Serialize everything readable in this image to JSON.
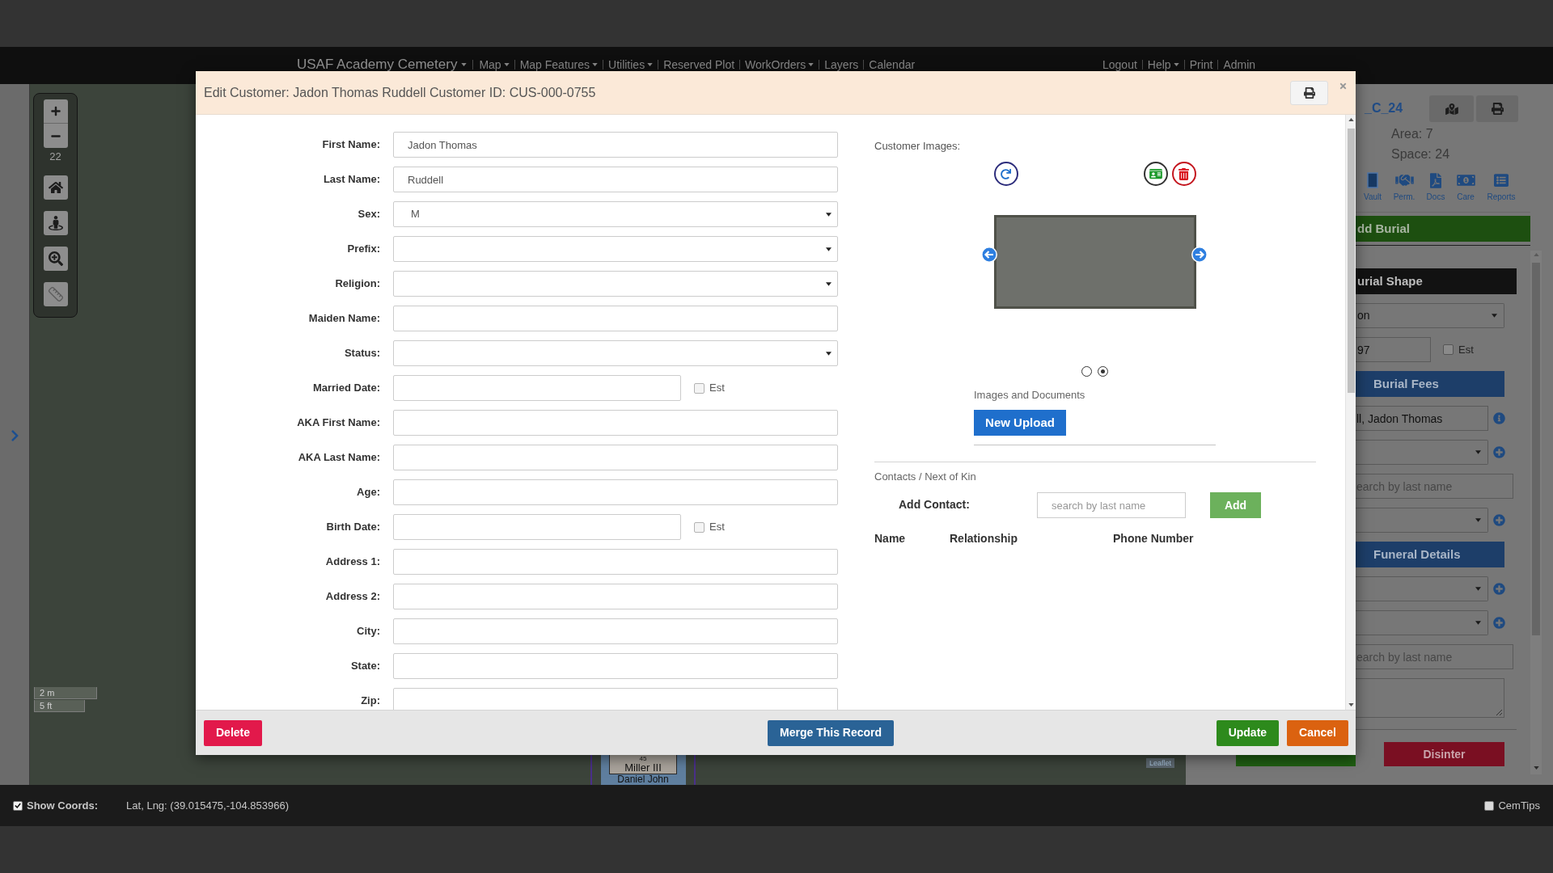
{
  "nav": {
    "brand": {
      "label": "USAF Academy Cemetery",
      "dropdown": true
    },
    "menu": [
      {
        "label": "Map",
        "dropdown": true
      },
      {
        "label": "Map Features",
        "dropdown": true
      },
      {
        "label": "Utilities",
        "dropdown": true
      },
      {
        "label": "Reserved Plot",
        "dropdown": false
      },
      {
        "label": "WorkOrders",
        "dropdown": true
      },
      {
        "label": "Layers",
        "dropdown": false
      },
      {
        "label": "Calendar",
        "dropdown": false
      }
    ],
    "right_menu": [
      {
        "label": "Logout",
        "dropdown": false
      },
      {
        "label": "Help",
        "dropdown": true
      },
      {
        "label": "Print",
        "dropdown": false
      },
      {
        "label": "Admin",
        "dropdown": false
      }
    ]
  },
  "map": {
    "zoom_level": "22",
    "scale": [
      "2 m",
      "5 ft"
    ],
    "plot": {
      "number": "45",
      "names": [
        "Miller III",
        "Daniel John"
      ]
    },
    "attribution": "Leaflet"
  },
  "sidebar": {
    "title": "_C_24",
    "details": [
      "Area: 7",
      "Space: 24"
    ],
    "tools": [
      {
        "kind": "vault",
        "label": "Vault"
      },
      {
        "kind": "permit",
        "label": "Perm."
      },
      {
        "kind": "docs",
        "label": "Docs"
      },
      {
        "kind": "care",
        "label": "Care"
      },
      {
        "kind": "reports",
        "label": "Reports"
      }
    ],
    "add_button": "dd Burial",
    "form": [
      {
        "kind": "header",
        "label": "urial Shape"
      },
      {
        "kind": "select",
        "value": "on"
      },
      {
        "kind": "date",
        "value": "97",
        "est": {
          "label": "Est",
          "checked": false
        }
      },
      {
        "kind": "section",
        "label": "Burial Fees"
      },
      {
        "kind": "input",
        "value": "ll, Jadon Thomas",
        "info": true
      },
      {
        "kind": "select",
        "addable": true
      },
      {
        "kind": "search",
        "placeholder": "earch by last name"
      },
      {
        "kind": "select",
        "addable": true
      },
      {
        "kind": "section",
        "label": "Funeral Details"
      },
      {
        "kind": "select",
        "addable": true
      },
      {
        "kind": "select",
        "addable": true
      },
      {
        "kind": "search",
        "placeholder": "earch by last name"
      },
      {
        "kind": "textarea"
      }
    ],
    "disinter_button": "Disinter"
  },
  "modal": {
    "title": "Edit Customer: Jadon Thomas Ruddell Customer ID: CUS-000-0755",
    "fields": [
      {
        "label": "First Name:",
        "kind": "text",
        "value": "Jadon Thomas"
      },
      {
        "label": "Last Name:",
        "kind": "text",
        "value": "Ruddell"
      },
      {
        "label": "Sex:",
        "kind": "select",
        "value": "M"
      },
      {
        "label": "Prefix:",
        "kind": "select"
      },
      {
        "label": "Religion:",
        "kind": "select"
      },
      {
        "label": "Maiden Name:",
        "kind": "text"
      },
      {
        "label": "Status:",
        "kind": "select"
      },
      {
        "label": "Married Date:",
        "kind": "date",
        "est": {
          "label": "Est",
          "checked": false
        }
      },
      {
        "label": "AKA First Name:",
        "kind": "text"
      },
      {
        "label": "AKA Last Name:",
        "kind": "text"
      },
      {
        "label": "Age:",
        "kind": "text"
      },
      {
        "label": "Birth Date:",
        "kind": "date",
        "est": {
          "label": "Est",
          "checked": false
        }
      },
      {
        "label": "Address 1:",
        "kind": "text"
      },
      {
        "label": "Address 2:",
        "kind": "text"
      },
      {
        "label": "City:",
        "kind": "text"
      },
      {
        "label": "State:",
        "kind": "text"
      },
      {
        "label": "Zip:",
        "kind": "text"
      }
    ],
    "images": {
      "label": "Customer Images:",
      "slides": [
        {
          "selected": false
        },
        {
          "selected": true
        }
      ],
      "documents_label": "Images and Documents",
      "upload_button": "New Upload"
    },
    "contacts": {
      "title": "Contacts / Next of Kin",
      "add_label": "Add Contact:",
      "search": {
        "placeholder": "search by last name"
      },
      "add_button": "Add",
      "columns": [
        "Name",
        "Relationship",
        "Phone Number"
      ]
    },
    "footer": {
      "left": [
        {
          "label": "Delete",
          "kind": "danger"
        }
      ],
      "center": [
        {
          "label": "Merge This Record",
          "kind": "primary"
        }
      ],
      "right": [
        {
          "label": "Update",
          "kind": "success"
        },
        {
          "label": "Cancel",
          "kind": "warning"
        }
      ]
    }
  },
  "status_bar": {
    "show_coords": {
      "label": "Show Coords:",
      "checked": true
    },
    "coords": "Lat, Lng: (39.015475,-104.853966)",
    "tips": {
      "label": "CemTips",
      "checked": false
    }
  }
}
